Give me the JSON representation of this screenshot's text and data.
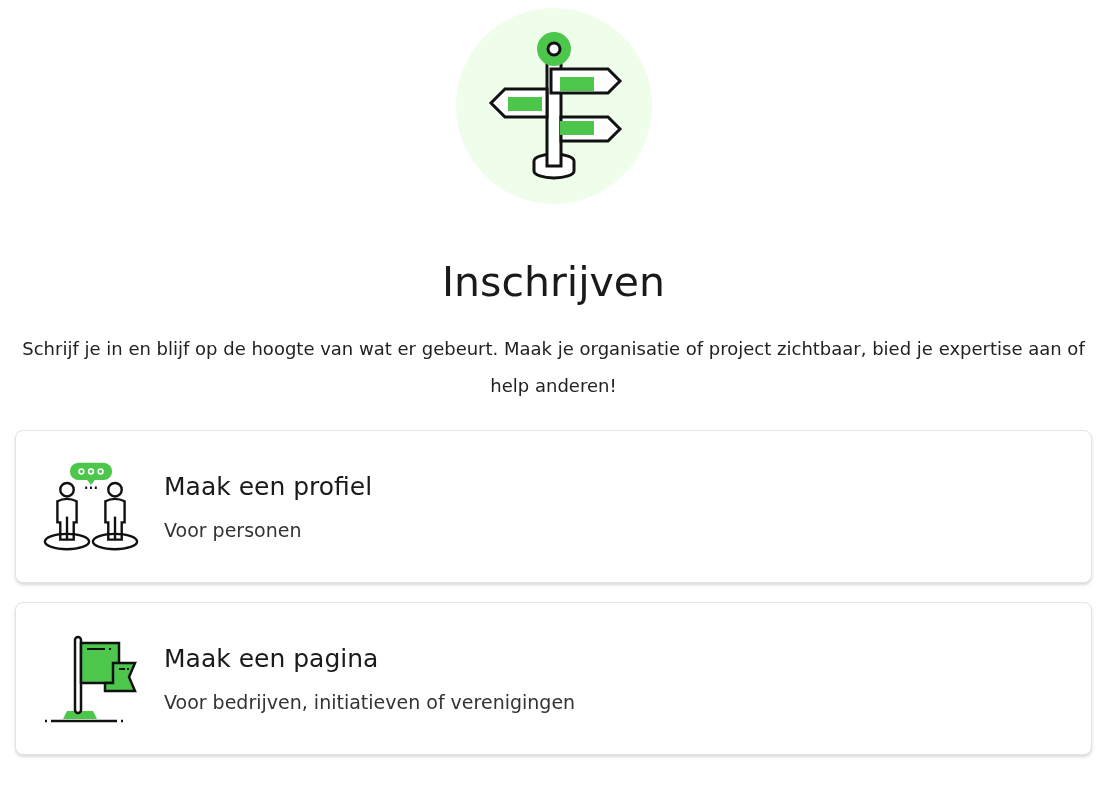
{
  "title": "Inschrijven",
  "intro": "Schrijf je in en blijf op de hoogte van wat er gebeurt. Maak je organisatie of project zichtbaar, bied je expertise aan of help anderen!",
  "options": [
    {
      "kind": "people",
      "title": "Maak een profiel",
      "subtitle": "Voor personen"
    },
    {
      "kind": "flag",
      "title": "Maak een pagina",
      "subtitle": "Voor bedrijven, initiatieven of verenigingen"
    }
  ]
}
